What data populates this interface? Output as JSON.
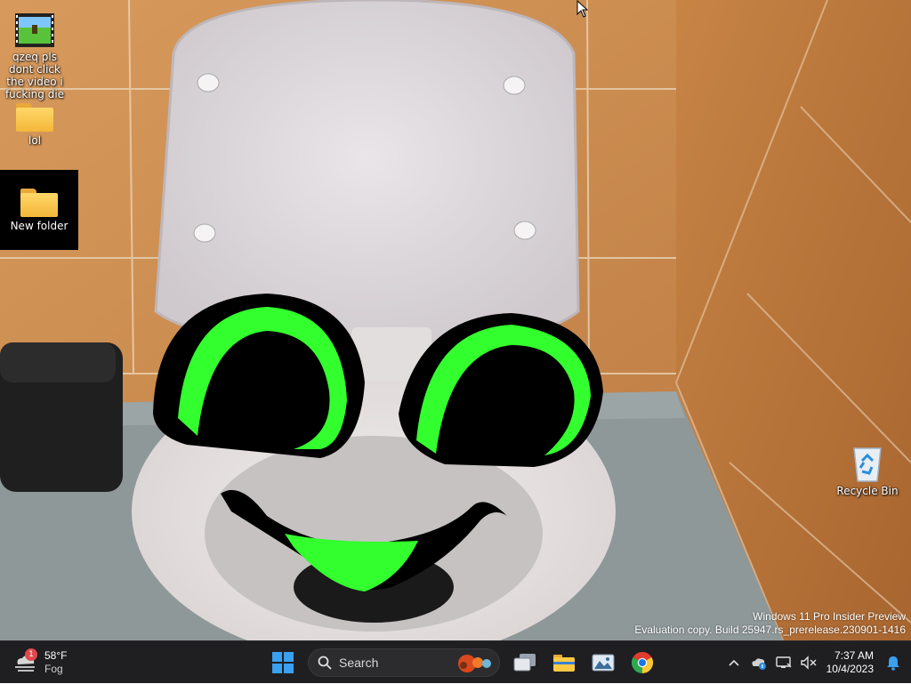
{
  "desktop": {
    "icons": [
      {
        "label": "qzeq pls dont click the video i fucking die",
        "type": "video"
      },
      {
        "label": "lol",
        "type": "folder"
      },
      {
        "label": "New folder",
        "type": "folder"
      },
      {
        "label": "Recycle Bin",
        "type": "recycle-bin"
      }
    ]
  },
  "watermark": {
    "line1": "Windows 11 Pro Insider Preview",
    "line2": "Evaluation copy. Build 25947.rs_prerelease.230901-1416"
  },
  "taskbar": {
    "weather": {
      "temperature": "58°F",
      "condition": "Fog",
      "badge": "1"
    },
    "search": {
      "placeholder": "Search"
    },
    "pinned": [
      "start-icon",
      "search-icon",
      "task-view-icon",
      "file-explorer-icon",
      "photos-icon",
      "chrome-icon"
    ],
    "tray": [
      "chevron-up-icon",
      "onedrive-icon",
      "network-icon",
      "volume-muted-icon",
      "notification-bell-icon"
    ],
    "clock": {
      "time": "7:37 AM",
      "date": "10/4/2023"
    }
  },
  "colors": {
    "taskbar_bg": "#1f1f21",
    "win_blue": "#2b9be8",
    "eye_green": "#33ff2e",
    "tile": "#c98a4f"
  }
}
